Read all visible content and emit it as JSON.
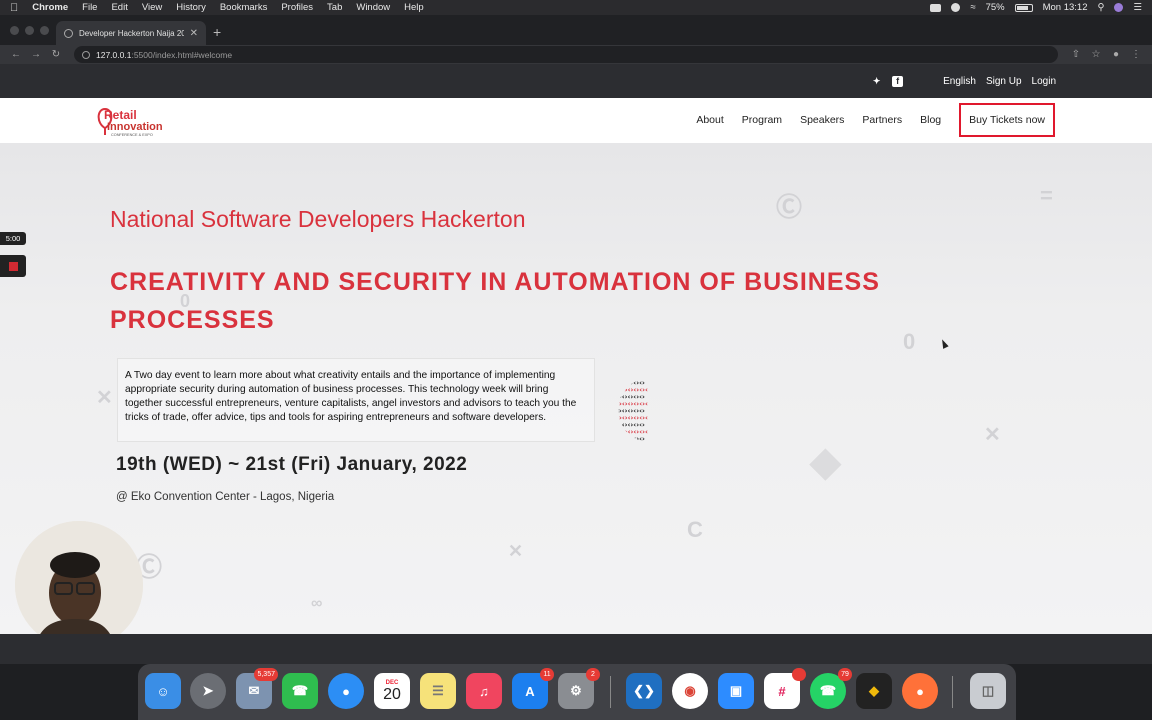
{
  "menubar": {
    "app": "Chrome",
    "items": [
      "File",
      "Edit",
      "View",
      "History",
      "Bookmarks",
      "Profiles",
      "Tab",
      "Window",
      "Help"
    ],
    "battery": "75%",
    "clock": "Mon 13:12"
  },
  "browser": {
    "tab_title": "Developer Hackerton Naija 20...",
    "url_host": "127.0.0.1",
    "url_rest": ":5500/index.html#welcome"
  },
  "site": {
    "topbar": {
      "language": "English",
      "signup": "Sign Up",
      "login": "Login"
    },
    "logo": {
      "line1": "Retail",
      "line2": "Innovation",
      "tagline": "CONFERENCE & EXPO"
    },
    "nav": [
      "About",
      "Program",
      "Speakers",
      "Partners",
      "Blog"
    ],
    "cta": "Buy Tickets now",
    "subtitle": "National Software Developers Hackerton",
    "headline": "CREATIVITY AND SECURITY IN AUTOMATION OF BUSINESS PROCESSES",
    "description": "A Two day event to learn more about what creativity entails and the importance of implementing appropriate security during automation of business processes. This technology week will bring together successful entrepreneurs, venture capitalists, angel investors and advisors to teach you the tricks of trade, offer advice, tips and tools for aspiring entrepreneurs and software developers.",
    "dates": "19th (WED) ~ 21st (Fri) January, 2022",
    "venue": "@ Eko Convention Center - Lagos, Nigeria"
  },
  "recording": {
    "timer": "5:00"
  },
  "dock": {
    "mail_badge": "5,357",
    "calendar_month": "DEC",
    "calendar_day": "20",
    "appstore_badge": "11",
    "settings_badge": "2",
    "whatsapp_badge": "79"
  },
  "colors": {
    "accent": "#d9323d",
    "cta_border": "#e0182d"
  }
}
